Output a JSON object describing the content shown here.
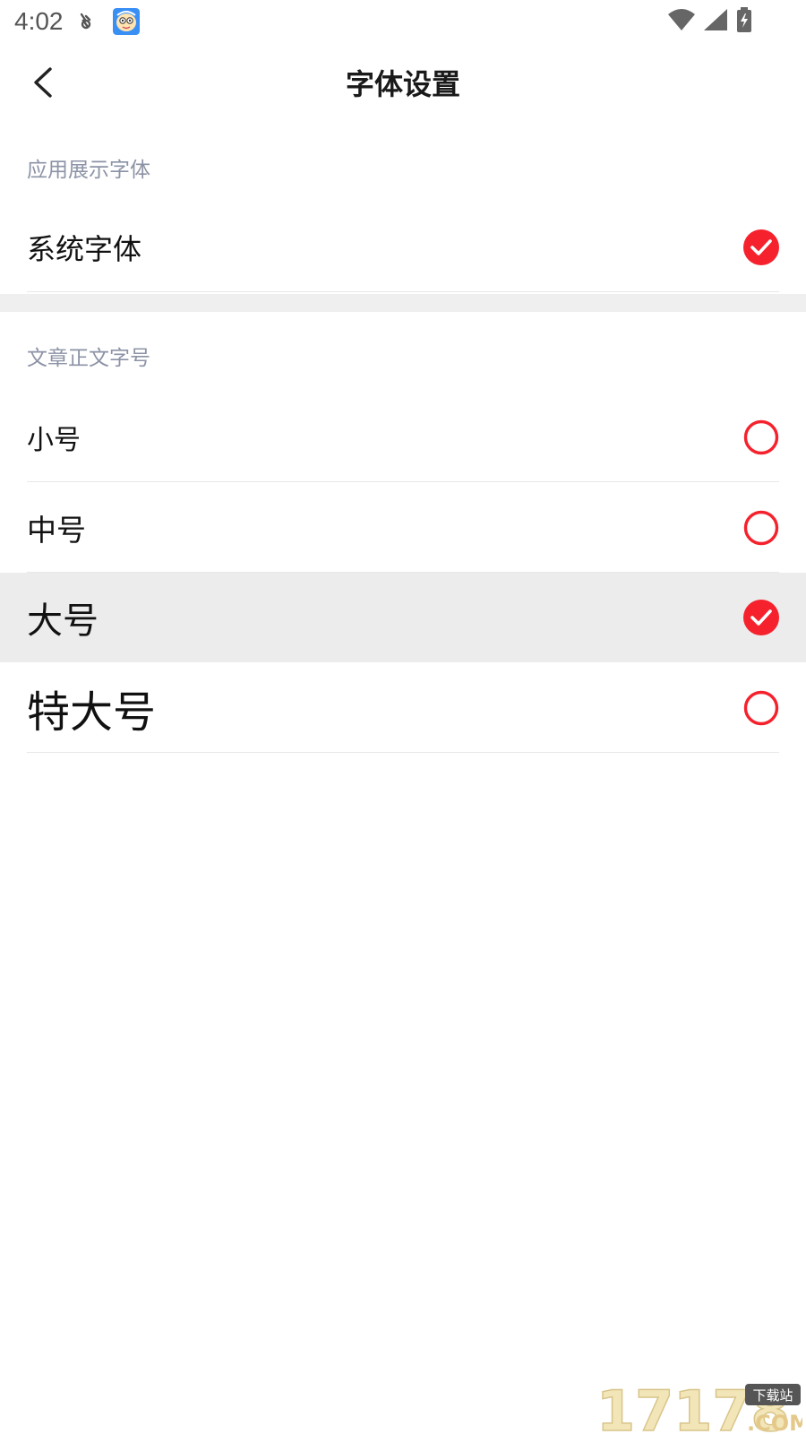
{
  "status_bar": {
    "time": "4:02",
    "notification_icon": "flash-icon",
    "app_icon": "cartoon-app-icon",
    "wifi_icon": "wifi-icon",
    "signal_icon": "signal-icon",
    "battery_icon": "battery-charging-icon"
  },
  "header": {
    "back_icon": "chevron-left-icon",
    "title": "字体设置"
  },
  "app_font_section": {
    "label": "应用展示字体",
    "options": [
      {
        "label": "系统字体",
        "selected": true
      }
    ]
  },
  "article_font_size_section": {
    "label": "文章正文字号",
    "options": [
      {
        "label": "小号",
        "selected": false
      },
      {
        "label": "中号",
        "selected": false
      },
      {
        "label": "大号",
        "selected": true
      },
      {
        "label": "特大号",
        "selected": false
      }
    ]
  },
  "colors": {
    "accent": "#f5222d",
    "section_label": "#8c93a6",
    "highlight_row": "#ececec"
  },
  "watermark": {
    "text": "17178",
    "suffix": ".COM",
    "badge": "下载站"
  }
}
